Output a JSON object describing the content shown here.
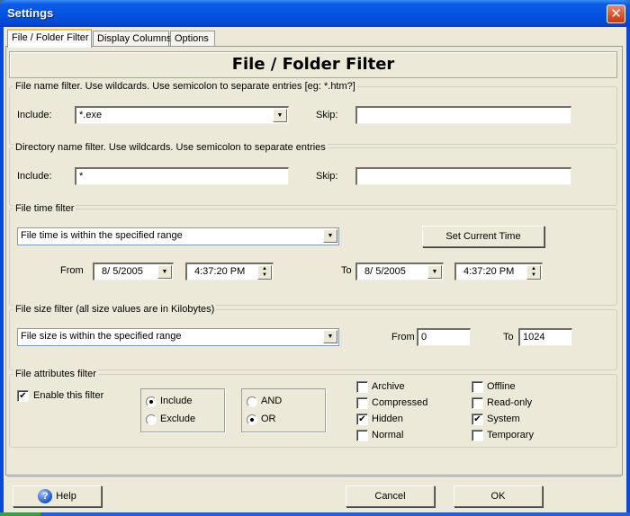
{
  "window": {
    "title": "Settings",
    "close_icon": "close-icon"
  },
  "tabs": [
    {
      "label": "File / Folder Filter",
      "active": true
    },
    {
      "label": "Display Columns",
      "active": false
    },
    {
      "label": "Options",
      "active": false
    }
  ],
  "header": {
    "title": "File / Folder Filter"
  },
  "file_name_filter": {
    "legend": "File name filter. Use wildcards. Use semicolon to separate entries [eg: *.htm?]",
    "include_label": "Include:",
    "include_value": "*.exe",
    "skip_label": "Skip:",
    "skip_value": ""
  },
  "dir_name_filter": {
    "legend": "Directory name filter. Use wildcards. Use semicolon to separate entries",
    "include_label": "Include:",
    "include_value": "*",
    "skip_label": "Skip:",
    "skip_value": ""
  },
  "file_time_filter": {
    "legend": "File time filter",
    "mode": "File time is within the specified range",
    "set_current_time_label": "Set Current Time",
    "from_label": "From",
    "from_date": "8/  5/2005",
    "from_time": "4:37:20 PM",
    "to_label": "To",
    "to_date": "8/  5/2005",
    "to_time": "4:37:20 PM"
  },
  "file_size_filter": {
    "legend": "File size filter (all size values are in Kilobytes)",
    "mode": "File size is within the specified range",
    "from_label": "From",
    "from_value": "0",
    "to_label": "To",
    "to_value": "1024"
  },
  "file_attributes_filter": {
    "legend": "File attributes filter",
    "enable_label": "Enable this filter",
    "enable_checked": true,
    "include_exclude": [
      {
        "label": "Include",
        "selected": true
      },
      {
        "label": "Exclude",
        "selected": false
      }
    ],
    "and_or": [
      {
        "label": "AND",
        "selected": false
      },
      {
        "label": "OR",
        "selected": true
      }
    ],
    "attributes": [
      {
        "label": "Archive",
        "checked": false
      },
      {
        "label": "Compressed",
        "checked": false
      },
      {
        "label": "Hidden",
        "checked": true
      },
      {
        "label": "Normal",
        "checked": false
      },
      {
        "label": "Offline",
        "checked": false
      },
      {
        "label": "Read-only",
        "checked": false
      },
      {
        "label": "System",
        "checked": true
      },
      {
        "label": "Temporary",
        "checked": false
      }
    ]
  },
  "footer": {
    "help_label": "Help",
    "cancel_label": "Cancel",
    "ok_label": "OK"
  },
  "glyphs": {
    "close": "✕",
    "dropdown": "▼",
    "spin_up": "▲",
    "spin_down": "▼",
    "check": "✔",
    "help": "?"
  }
}
